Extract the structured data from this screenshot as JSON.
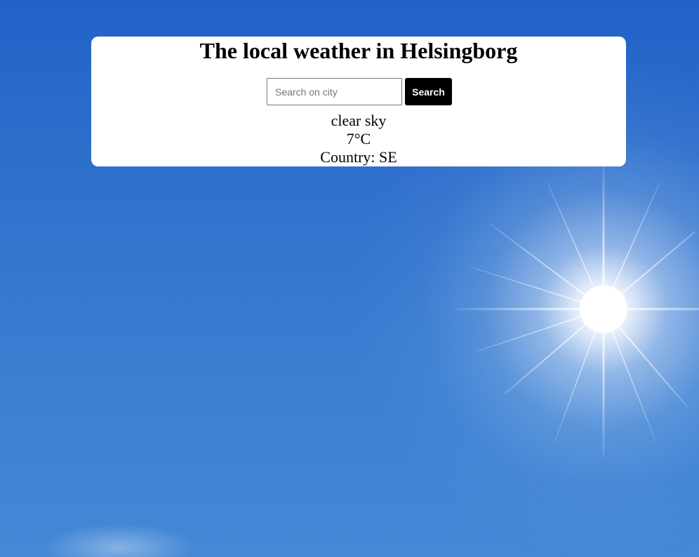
{
  "page": {
    "title": "The local weather in Helsingborg"
  },
  "search": {
    "placeholder": "Search on city",
    "value": "",
    "button_label": "Search"
  },
  "weather": {
    "description": "clear sky",
    "temperature": "7°C",
    "country": "Country: SE"
  },
  "background": {
    "theme": "sunny-blue-sky",
    "sky_color": "#2f6fcc",
    "sun_color": "#ffffff"
  }
}
